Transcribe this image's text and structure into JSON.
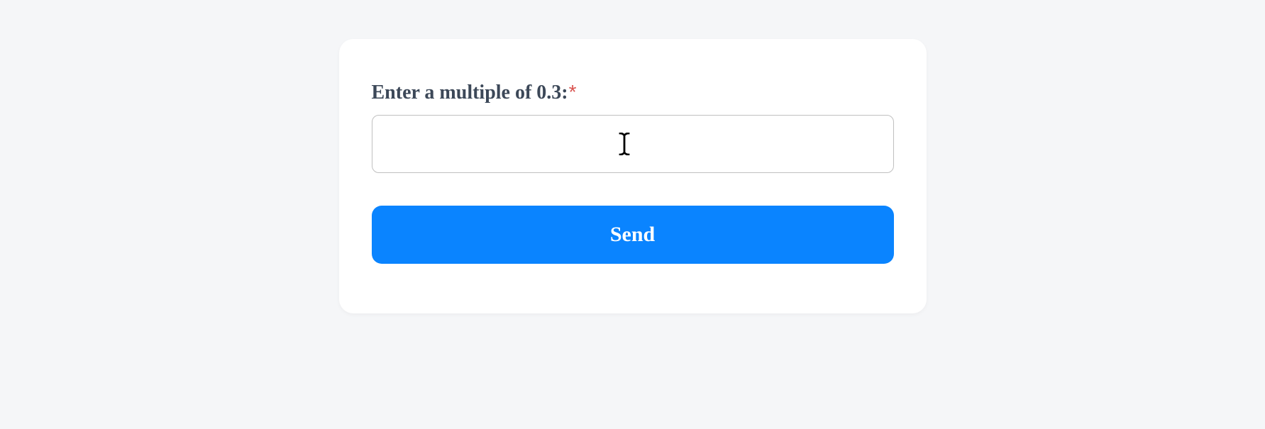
{
  "form": {
    "label": "Enter a multiple of 0.3:",
    "required_marker": "*",
    "input_value": "",
    "input_placeholder": "",
    "submit_label": "Send"
  },
  "colors": {
    "accent": "#0a84ff",
    "text": "#3c4858",
    "required": "#d9534f",
    "border": "#c0c0c0",
    "background": "#f5f6f8",
    "card": "#ffffff"
  }
}
